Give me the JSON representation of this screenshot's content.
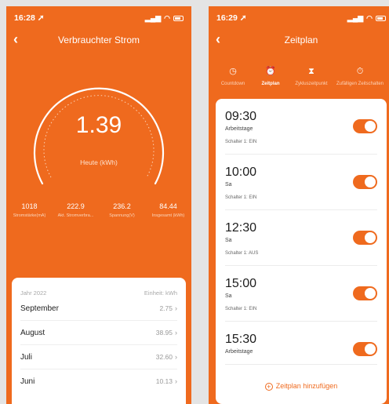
{
  "screen1": {
    "status_time": "16:28",
    "title": "Verbrauchter Strom",
    "gauge_value": "1.39",
    "gauge_unit": "Heute (kWh)",
    "stats": [
      {
        "value": "1018",
        "label": "Stromstärke(mA)"
      },
      {
        "value": "222.9",
        "label": "Akt. Stromverbra..."
      },
      {
        "value": "236.2",
        "label": "Spannung(V)"
      },
      {
        "value": "84.44",
        "label": "Insgesamt (kWh)"
      }
    ],
    "sheet": {
      "year": "Jahr 2022",
      "unit": "Einheit: kWh",
      "months": [
        {
          "name": "September",
          "amount": "2.75"
        },
        {
          "name": "August",
          "amount": "38.95"
        },
        {
          "name": "Juli",
          "amount": "32.60"
        },
        {
          "name": "Juni",
          "amount": "10.13"
        }
      ]
    }
  },
  "screen2": {
    "status_time": "16:29",
    "title": "Zeitplan",
    "modes": [
      {
        "label": "Countdown",
        "icon": "clock-icon"
      },
      {
        "label": "Zeitplan",
        "icon": "alarm-icon"
      },
      {
        "label": "Zykluszeitpunkt",
        "icon": "hourglass-icon"
      },
      {
        "label": "Zufälligen Zeitschalten",
        "icon": "timer-icon"
      }
    ],
    "schedules": [
      {
        "time": "09:30",
        "days": "Arbeitstage",
        "switch": "Schalter 1: EIN"
      },
      {
        "time": "10:00",
        "days": "Sa",
        "switch": "Schalter 1: EIN"
      },
      {
        "time": "12:30",
        "days": "Sa",
        "switch": "Schalter 1: AUS"
      },
      {
        "time": "15:00",
        "days": "Sa",
        "switch": "Schalter 1: EIN"
      },
      {
        "time": "15:30",
        "days": "Arbeitstage",
        "switch": ""
      }
    ],
    "add_label": "Zeitplan hinzufügen"
  },
  "colors": {
    "accent": "#ef6a1e",
    "background": "#e4e4e4"
  }
}
